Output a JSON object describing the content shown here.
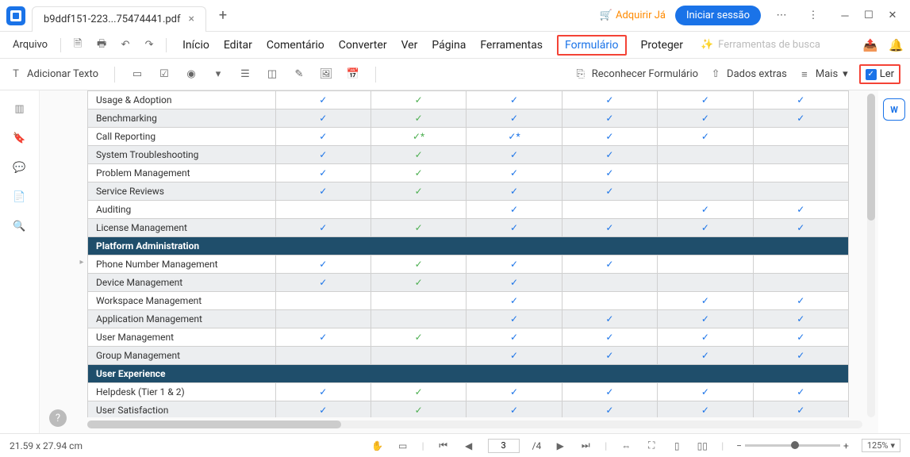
{
  "titlebar": {
    "tab_name": "b9ddf151-223...75474441.pdf",
    "acquire": "Adquirir Já",
    "signin": "Iniciar sessão"
  },
  "menubar": {
    "file": "Arquivo",
    "items": [
      "Início",
      "Editar",
      "Comentário",
      "Converter",
      "Ver",
      "Página",
      "Ferramentas",
      "Formulário",
      "Proteger"
    ],
    "search": "Ferramentas de busca"
  },
  "toolbar": {
    "add_text": "Adicionar Texto",
    "recognize": "Reconhecer Formulário",
    "extra": "Dados extras",
    "more": "Mais",
    "read": "Ler"
  },
  "statusbar": {
    "dims": "21.59 x 27.94 cm",
    "page": "3",
    "pages": "/4",
    "zoom": "125%"
  },
  "table": {
    "rows": [
      {
        "type": "row",
        "alt": false,
        "label": "Usage & Adoption",
        "cols": [
          "b",
          "g",
          "b",
          "b",
          "b",
          "b"
        ]
      },
      {
        "type": "row",
        "alt": true,
        "label": "Benchmarking",
        "cols": [
          "b",
          "g",
          "b",
          "b",
          "b",
          "b"
        ]
      },
      {
        "type": "row",
        "alt": false,
        "label": "Call Reporting",
        "cols": [
          "b",
          "g*",
          "b*",
          "b",
          "b",
          ""
        ]
      },
      {
        "type": "row",
        "alt": true,
        "label": "System Troubleshooting",
        "cols": [
          "b",
          "g",
          "b",
          "b",
          "",
          ""
        ]
      },
      {
        "type": "row",
        "alt": false,
        "label": "Problem Management",
        "cols": [
          "b",
          "g",
          "b",
          "b",
          "",
          ""
        ]
      },
      {
        "type": "row",
        "alt": true,
        "label": "Service Reviews",
        "cols": [
          "b",
          "g",
          "b",
          "b",
          "",
          ""
        ]
      },
      {
        "type": "row",
        "alt": false,
        "label": "Auditing",
        "cols": [
          "",
          "",
          "b",
          "",
          "b",
          "b"
        ]
      },
      {
        "type": "row",
        "alt": true,
        "label": "License Management",
        "cols": [
          "b",
          "g",
          "b",
          "b",
          "b",
          "b"
        ]
      },
      {
        "type": "section",
        "label": "Platform Administration"
      },
      {
        "type": "row",
        "alt": false,
        "label": "Phone Number Management",
        "cols": [
          "b",
          "g",
          "b",
          "b",
          "",
          ""
        ]
      },
      {
        "type": "row",
        "alt": true,
        "label": "Device Management",
        "cols": [
          "b",
          "g",
          "b",
          "",
          "",
          ""
        ]
      },
      {
        "type": "row",
        "alt": false,
        "label": "Workspace Management",
        "cols": [
          "",
          "",
          "b",
          "",
          "b",
          "b"
        ]
      },
      {
        "type": "row",
        "alt": true,
        "label": "Application Management",
        "cols": [
          "",
          "",
          "b",
          "b",
          "b",
          "b"
        ]
      },
      {
        "type": "row",
        "alt": false,
        "label": "User Management",
        "cols": [
          "b",
          "g",
          "b",
          "b",
          "b",
          "b"
        ]
      },
      {
        "type": "row",
        "alt": true,
        "label": "Group Management",
        "cols": [
          "",
          "",
          "b",
          "b",
          "b",
          "b"
        ]
      },
      {
        "type": "section",
        "label": "User Experience"
      },
      {
        "type": "row",
        "alt": false,
        "label": "Helpdesk (Tier 1 & 2)",
        "cols": [
          "b",
          "g",
          "b",
          "b",
          "b",
          "b"
        ]
      },
      {
        "type": "row",
        "alt": true,
        "label": "User Satisfaction",
        "cols": [
          "b",
          "g",
          "b",
          "b",
          "b",
          "b"
        ]
      }
    ]
  }
}
